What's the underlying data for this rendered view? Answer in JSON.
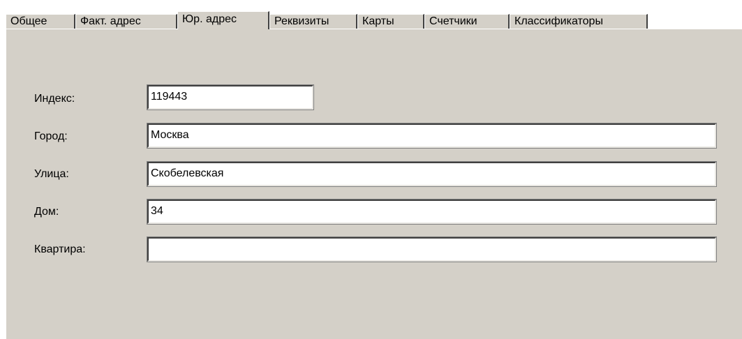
{
  "tabs": [
    {
      "label": "Общее"
    },
    {
      "label": "Факт. адрес"
    },
    {
      "label": "Юр. адрес",
      "active": true
    },
    {
      "label": "Реквизиты"
    },
    {
      "label": "Карты"
    },
    {
      "label": "Счетчики"
    },
    {
      "label": "Классификаторы"
    }
  ],
  "form": {
    "index": {
      "label": "Индекс:",
      "value": "119443"
    },
    "city": {
      "label": "Город:",
      "value": "Москва"
    },
    "street": {
      "label": "Улица:",
      "value": "Скобелевская"
    },
    "house": {
      "label": "Дом:",
      "value": "34"
    },
    "apartment": {
      "label": "Квартира:",
      "value": ""
    }
  },
  "colors": {
    "panel_background": "#d4d0c8",
    "field_background": "#ffffff"
  }
}
